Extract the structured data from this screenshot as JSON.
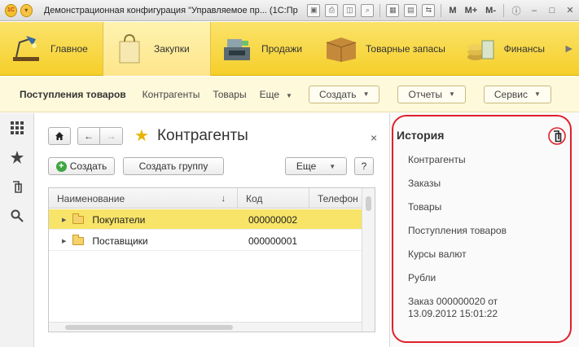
{
  "titlebar": {
    "title": "Демонстрационная конфигурация \"Управляемое пр... (1С:Предприятие)",
    "m": "M",
    "mplus": "M+",
    "mminus": "M-"
  },
  "sections": [
    {
      "label": "Главное",
      "icon": "desk-lamp-icon"
    },
    {
      "label": "Закупки",
      "icon": "shopping-bag-icon",
      "active": true
    },
    {
      "label": "Продажи",
      "icon": "cash-register-icon"
    },
    {
      "label": "Товарные запасы",
      "icon": "box-icon"
    },
    {
      "label": "Финансы",
      "icon": "coins-icon"
    }
  ],
  "funcbar": {
    "active": "Поступления товаров",
    "links": [
      "Контрагенты",
      "Товары"
    ],
    "more": "Еще",
    "buttons": [
      "Создать",
      "Отчеты",
      "Сервис"
    ]
  },
  "form": {
    "title": "Контрагенты",
    "create_btn": "Создать",
    "create_group_btn": "Создать группу",
    "more_btn": "Еще",
    "help_btn": "?",
    "columns": [
      "Наименование",
      "Код",
      "Телефон"
    ],
    "rows": [
      {
        "name": "Покупатели",
        "code": "000000002"
      },
      {
        "name": "Поставщики",
        "code": "000000001"
      }
    ]
  },
  "history": {
    "title": "История",
    "items": [
      "Контрагенты",
      "Заказы",
      "Товары",
      "Поступления товаров",
      "Курсы валют",
      "Рубли",
      "Заказ 000000020 от 13.09.2012 15:01:22"
    ]
  },
  "colors": {
    "section_bar": "#f5cf2a",
    "selected_row": "#f8e468",
    "highlight_outline": "#e0202a"
  }
}
